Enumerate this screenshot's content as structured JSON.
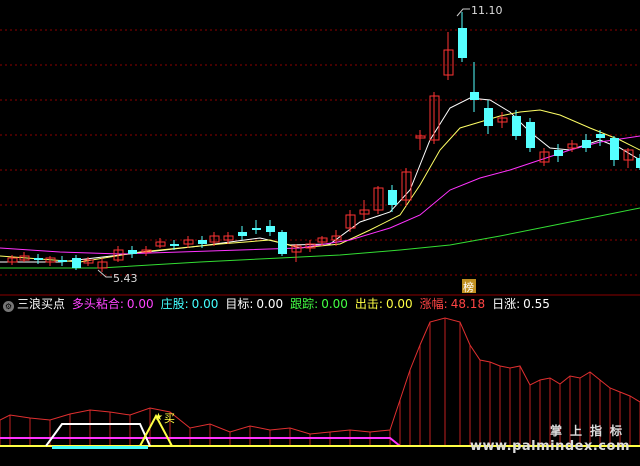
{
  "colors": {
    "up": "#ff3333",
    "down": "#55ffff",
    "ma_short": "#ffffff",
    "ma_mid": "#ffff66",
    "ma_long": "#ff33ff",
    "ma_vlong": "#33dd33",
    "grid": "#8b0000"
  },
  "price_chart": {
    "high_label": "11.10",
    "low_label": "5.43",
    "marker_label": "榜"
  },
  "indicator": {
    "icon": "gear-icon",
    "name": "三浪买点",
    "fields": [
      {
        "label": "多头粘合:",
        "value": "0.00",
        "color": "#ff44ff"
      },
      {
        "label": "庄股:",
        "value": "0.00",
        "color": "#44ffff"
      },
      {
        "label": "目标:",
        "value": "0.00",
        "color": "#ffffff"
      },
      {
        "label": "跟踪:",
        "value": "0.00",
        "color": "#44ff44"
      },
      {
        "label": "出击:",
        "value": "0.00",
        "color": "#ffff44"
      },
      {
        "label": "涨幅:",
        "value": "48.18",
        "color": "#ff4444"
      },
      {
        "label": "日涨:",
        "value": "0.55",
        "color": "#ffffff"
      }
    ],
    "buy_label": "买"
  },
  "watermark": {
    "line1": "掌上指标",
    "line2": "www.palmindex.com"
  }
}
